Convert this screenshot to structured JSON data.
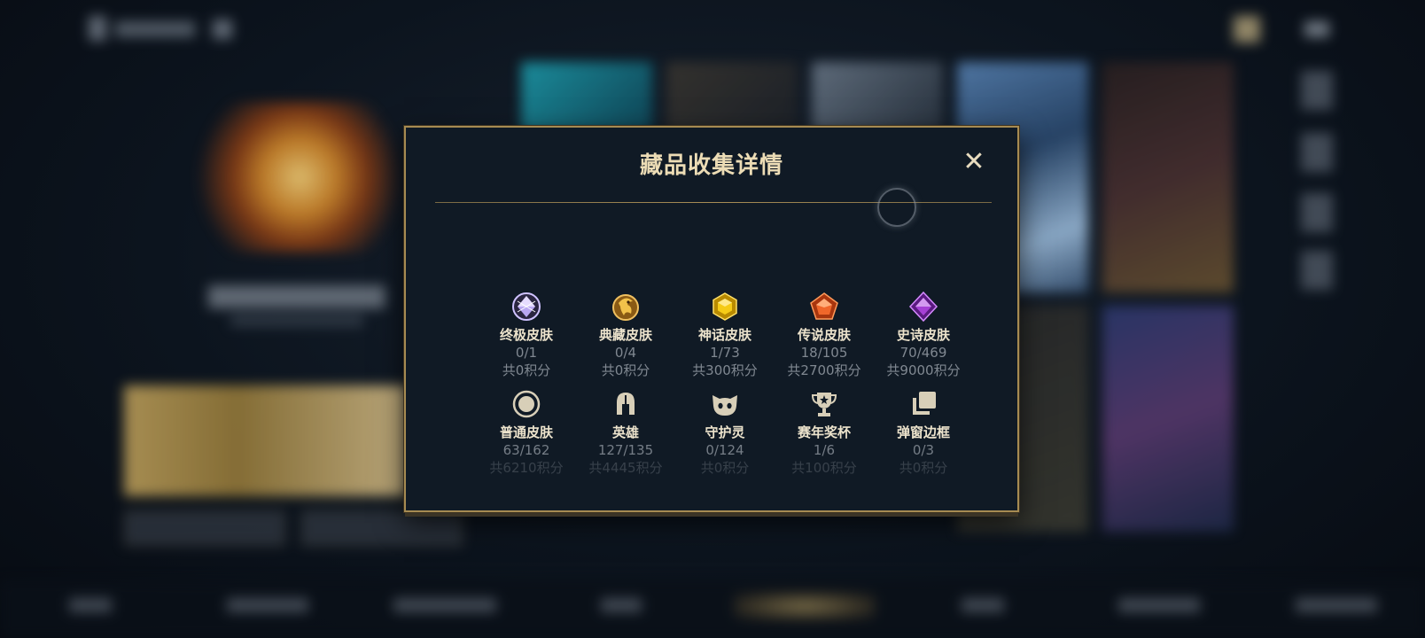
{
  "modal": {
    "title": "藏品收集详情",
    "close_glyph": "✕"
  },
  "categories": [
    {
      "label": "终极皮肤",
      "count": "0/1",
      "points": "共0积分",
      "icon": "ultimate-gem-icon",
      "color": "#b9a7f2"
    },
    {
      "label": "典藏皮肤",
      "count": "0/4",
      "points": "共0积分",
      "icon": "dragon-emblem-icon",
      "color": "#e0a63a"
    },
    {
      "label": "神话皮肤",
      "count": "1/73",
      "points": "共300积分",
      "icon": "mythic-hexagon-icon",
      "color": "#f0c21a"
    },
    {
      "label": "传说皮肤",
      "count": "18/105",
      "points": "共2700积分",
      "icon": "legendary-pentagon-icon",
      "color": "#f0672a"
    },
    {
      "label": "史诗皮肤",
      "count": "70/469",
      "points": "共9000积分",
      "icon": "epic-diamond-icon",
      "color": "#a640d6"
    },
    {
      "label": "普通皮肤",
      "count": "63/162",
      "points": "共6210积分",
      "icon": "common-circle-icon",
      "color": "#d8cfb8"
    },
    {
      "label": "英雄",
      "count": "127/135",
      "points": "共4445积分",
      "icon": "hero-helmet-icon",
      "color": "#d8cfb8"
    },
    {
      "label": "守护灵",
      "count": "0/124",
      "points": "共0积分",
      "icon": "guardian-cat-icon",
      "color": "#d8cfb8"
    },
    {
      "label": "赛年奖杯",
      "count": "1/6",
      "points": "共100积分",
      "icon": "trophy-icon",
      "color": "#d8cfb8"
    },
    {
      "label": "弹窗边框",
      "count": "0/3",
      "points": "共0积分",
      "icon": "frame-stack-icon",
      "color": "#d8cfb8"
    }
  ]
}
